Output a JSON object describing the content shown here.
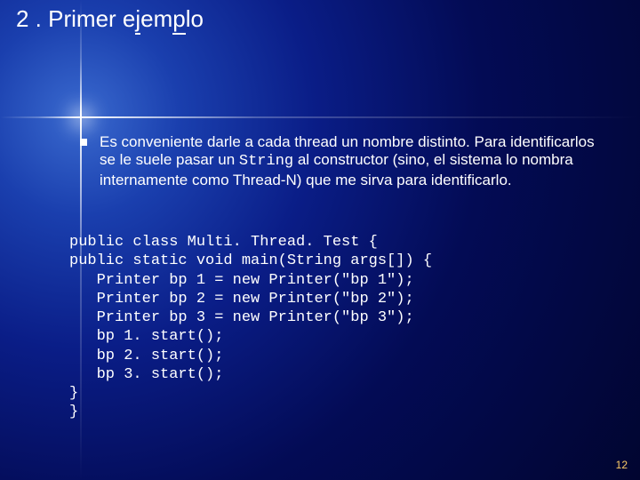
{
  "title_prefix": "2 . Primer e",
  "title_underlined_first": "j",
  "title_mid": "em",
  "title_underlined_second": "p",
  "title_suffix": "lo",
  "bullet_text_a": "Es conveniente darle a cada thread un nombre distinto. Para identificarlos se le suele pasar un ",
  "bullet_text_mono": "String",
  "bullet_text_b": " al constructor (sino, el sistema lo nombra internamente como Thread-N) que me sirva para identificarlo.",
  "code": "public class Multi. Thread. Test {\npublic static void main(String args[]) {\n   Printer bp 1 = new Printer(\"bp 1\");\n   Printer bp 2 = new Printer(\"bp 2\");\n   Printer bp 3 = new Printer(\"bp 3\");\n   bp 1. start();\n   bp 2. start();\n   bp 3. start();\n}\n}",
  "page_number": "12"
}
